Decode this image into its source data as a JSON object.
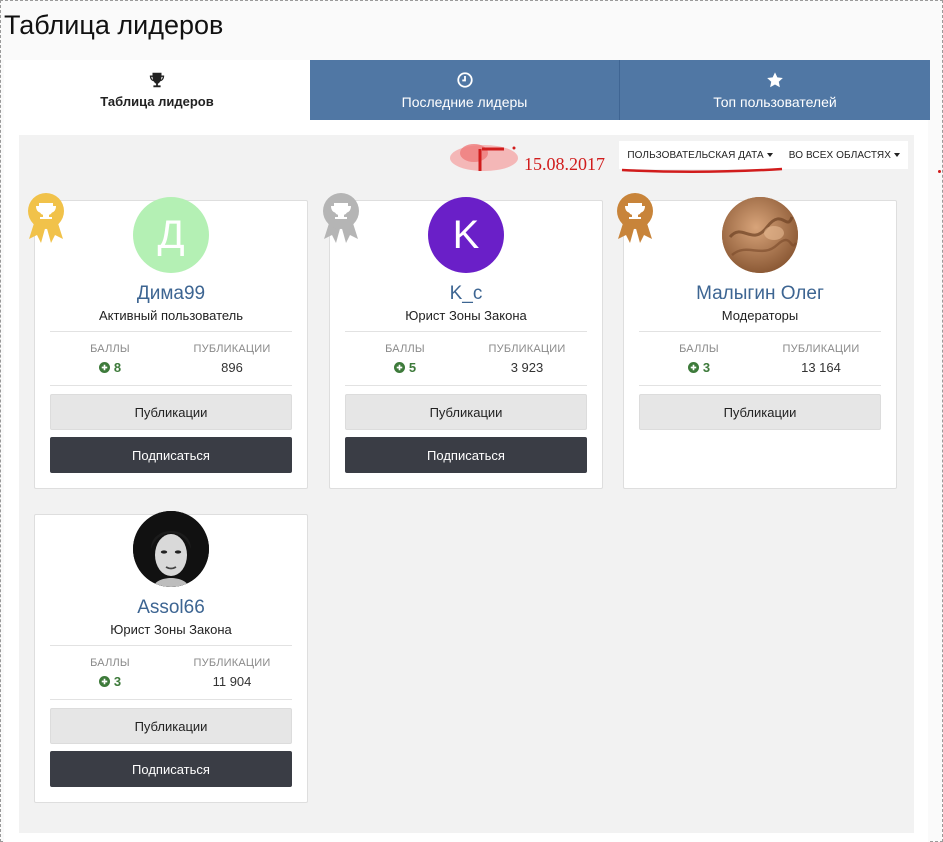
{
  "page": {
    "title": "Таблица лидеров"
  },
  "tabs": [
    {
      "label": "Таблица лидеров",
      "icon": "trophy-icon",
      "active": true
    },
    {
      "label": "Последние лидеры",
      "icon": "clock-icon",
      "active": false
    },
    {
      "label": "Топ пользователей",
      "icon": "star-icon",
      "active": false
    }
  ],
  "filters": {
    "date": "Пользовательская дата",
    "area": "Во всех областях"
  },
  "annotation": {
    "date": "15.08.2017",
    "color": "#d11c1c"
  },
  "stats_labels": {
    "points": "Баллы",
    "publications": "Публикации"
  },
  "buttons": {
    "publications": "Публикации",
    "follow": "Подписаться"
  },
  "colors": {
    "tab_blue": "#5077a4",
    "gold": "#f1c24a",
    "silver": "#b5b5b5",
    "bronze": "#c8843a",
    "follow_button": "#3a3d45",
    "name_link": "#3d6592"
  },
  "leaders": [
    {
      "rank_badge": "gold",
      "avatar_letter": "Д",
      "avatar_color": "#b4f0b4",
      "name": "Дима99",
      "role": "Активный пользователь",
      "points": "8",
      "publications": "896",
      "has_follow": true
    },
    {
      "rank_badge": "silver",
      "avatar_letter": "K",
      "avatar_color": "#6a1fc8",
      "name": "K_c",
      "role": "Юрист Зоны Закона",
      "points": "5",
      "publications": "3 923",
      "has_follow": true
    },
    {
      "rank_badge": "bronze",
      "avatar_letter": "",
      "avatar_color": "#b07a4e",
      "name": "Малыгин Олег",
      "role": "Модераторы",
      "points": "3",
      "publications": "13 164",
      "has_follow": false
    },
    {
      "rank_badge": "none",
      "avatar_letter": "",
      "avatar_color": "#1a1a1a",
      "name": "Assol66",
      "role": "Юрист Зоны Закона",
      "points": "3",
      "publications": "11 904",
      "has_follow": true
    }
  ]
}
